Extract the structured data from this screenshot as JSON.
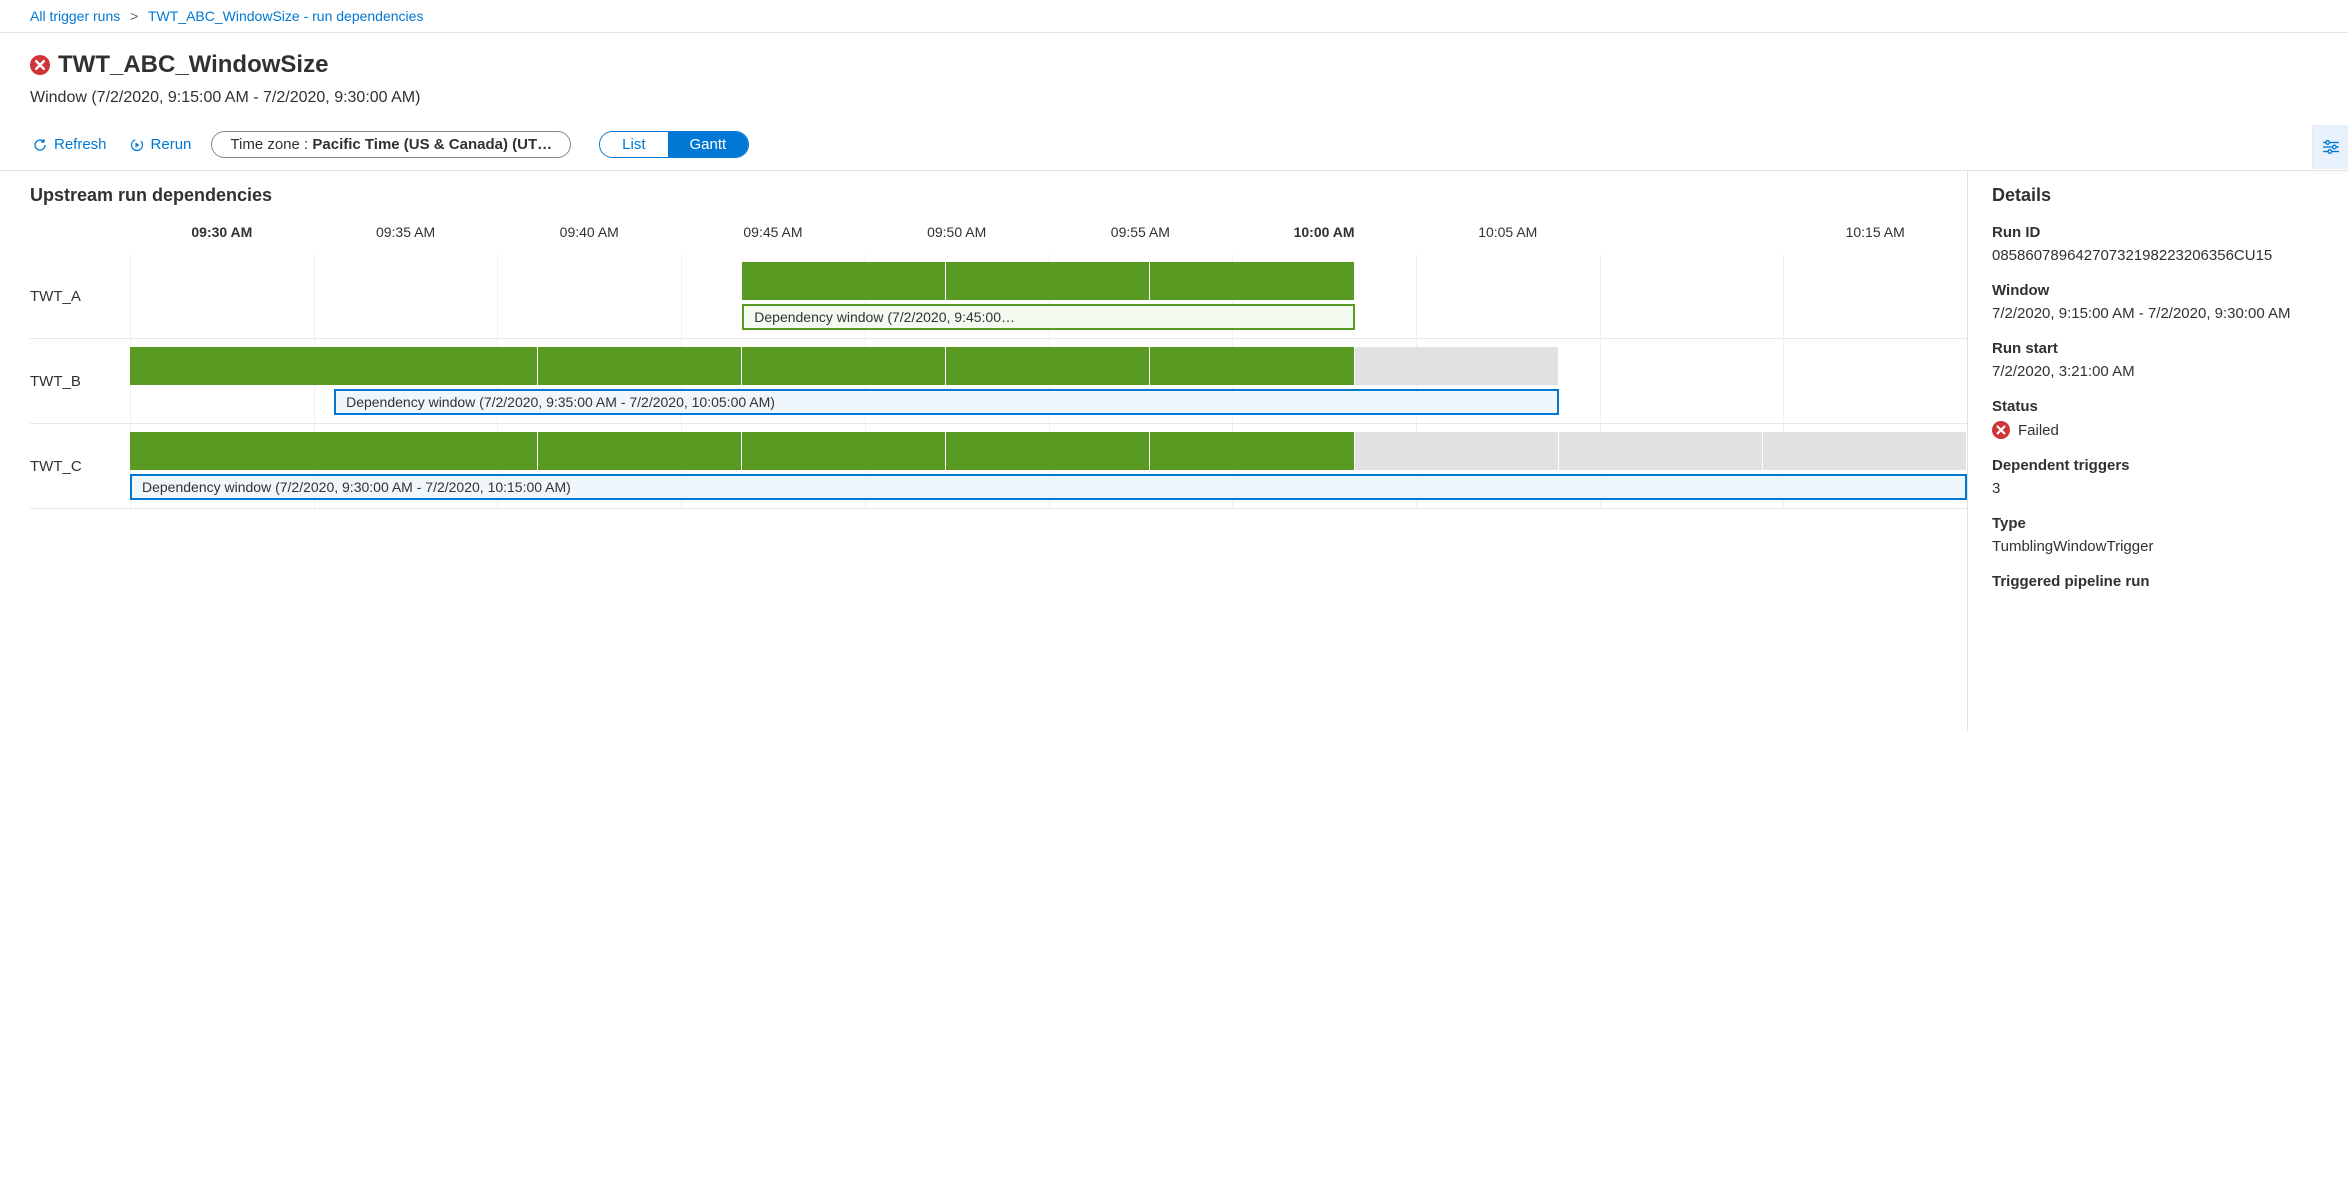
{
  "breadcrumb": {
    "root": "All trigger runs",
    "current": "TWT_ABC_WindowSize - run dependencies"
  },
  "header": {
    "title": "TWT_ABC_WindowSize",
    "window": "Window (7/2/2020, 9:15:00 AM - 7/2/2020, 9:30:00 AM)"
  },
  "toolbar": {
    "refresh": "Refresh",
    "rerun": "Rerun",
    "timezone_prefix": "Time zone : ",
    "timezone_value": "Pacific Time (US & Canada) (UT…",
    "list": "List",
    "gantt": "Gantt"
  },
  "gantt": {
    "title": "Upstream run dependencies",
    "ticks": [
      {
        "label": "09:30 AM",
        "bold": true
      },
      {
        "label": "09:35 AM",
        "bold": false
      },
      {
        "label": "09:40 AM",
        "bold": false
      },
      {
        "label": "09:45 AM",
        "bold": false
      },
      {
        "label": "09:50 AM",
        "bold": false
      },
      {
        "label": "09:55 AM",
        "bold": false
      },
      {
        "label": "10:00 AM",
        "bold": true
      },
      {
        "label": "10:05 AM",
        "bold": false
      },
      {
        "label": "",
        "bold": false
      },
      {
        "label": "10:15 AM",
        "bold": false
      }
    ],
    "rows": [
      {
        "name": "TWT_A",
        "segments": [
          {
            "startPct": 33.33,
            "widthPct": 11.11,
            "color": "green"
          },
          {
            "startPct": 44.44,
            "widthPct": 11.11,
            "color": "green"
          },
          {
            "startPct": 55.55,
            "widthPct": 11.11,
            "color": "green"
          }
        ],
        "dep": {
          "startPct": 33.33,
          "widthPct": 33.33,
          "label": "Dependency window (7/2/2020, 9:45:00…",
          "style": "green"
        }
      },
      {
        "name": "TWT_B",
        "segments": [
          {
            "startPct": 0,
            "widthPct": 22.22,
            "color": "green"
          },
          {
            "startPct": 22.22,
            "widthPct": 11.11,
            "color": "green"
          },
          {
            "startPct": 33.33,
            "widthPct": 11.11,
            "color": "green"
          },
          {
            "startPct": 44.44,
            "widthPct": 11.11,
            "color": "green"
          },
          {
            "startPct": 55.55,
            "widthPct": 11.11,
            "color": "green"
          },
          {
            "startPct": 66.66,
            "widthPct": 11.11,
            "color": "grey"
          }
        ],
        "dep": {
          "startPct": 11.11,
          "widthPct": 66.66,
          "label": "Dependency window (7/2/2020, 9:35:00 AM - 7/2/2020, 10:05:00 AM)",
          "style": "blue"
        }
      },
      {
        "name": "TWT_C",
        "segments": [
          {
            "startPct": 0,
            "widthPct": 22.22,
            "color": "green"
          },
          {
            "startPct": 22.22,
            "widthPct": 11.11,
            "color": "green"
          },
          {
            "startPct": 33.33,
            "widthPct": 11.11,
            "color": "green"
          },
          {
            "startPct": 44.44,
            "widthPct": 11.11,
            "color": "green"
          },
          {
            "startPct": 55.55,
            "widthPct": 11.11,
            "color": "green"
          },
          {
            "startPct": 66.66,
            "widthPct": 11.11,
            "color": "grey"
          },
          {
            "startPct": 77.77,
            "widthPct": 11.11,
            "color": "grey"
          },
          {
            "startPct": 88.88,
            "widthPct": 11.11,
            "color": "grey"
          }
        ],
        "dep": {
          "startPct": 0,
          "widthPct": 100,
          "label": "Dependency window (7/2/2020, 9:30:00 AM - 7/2/2020, 10:15:00 AM)",
          "style": "blue"
        }
      }
    ]
  },
  "details": {
    "title": "Details",
    "runid_label": "Run ID",
    "runid": "08586078964270732198223206356CU15",
    "window_label": "Window",
    "window": "7/2/2020, 9:15:00 AM - 7/2/2020, 9:30:00 AM",
    "runstart_label": "Run start",
    "runstart": "7/2/2020, 3:21:00 AM",
    "status_label": "Status",
    "status": "Failed",
    "deptrig_label": "Dependent triggers",
    "deptrig": "3",
    "type_label": "Type",
    "type": "TumblingWindowTrigger",
    "pipe_label": "Triggered pipeline run"
  }
}
